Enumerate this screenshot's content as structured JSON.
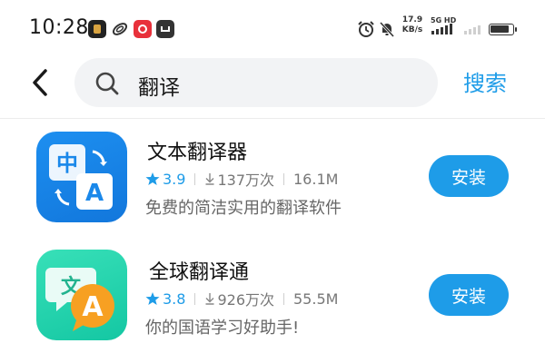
{
  "status_bar": {
    "time": "10:28",
    "net_speed_value": "17.9",
    "net_speed_unit": "KB/s",
    "network_type": "5G HD",
    "icons": [
      "game-app-notification-icon",
      "link-app-notification-icon",
      "netease-music-notification-icon",
      "mail-notification-icon",
      "alarm-icon",
      "mute-icon",
      "signal-icon",
      "battery-icon"
    ]
  },
  "search": {
    "query": "翻译",
    "submit_label": "搜索",
    "accent_color": "#1e9ce8"
  },
  "results": [
    {
      "name": "文本翻译器",
      "rating": "3.9",
      "downloads": "137万次",
      "size": "16.1M",
      "description": "免费的简洁实用的翻译软件",
      "install_label": "安装",
      "icon_glyph_top": "中",
      "icon_glyph_bottom": "A",
      "icon_color": "#1a88ea"
    },
    {
      "name": "全球翻译通",
      "rating": "3.8",
      "downloads": "926万次",
      "size": "55.5M",
      "description": "你的国语学习好助手!",
      "install_label": "安装",
      "icon_glyph_top": "文",
      "icon_glyph_bottom": "A",
      "icon_color": "#22d0ab"
    }
  ]
}
